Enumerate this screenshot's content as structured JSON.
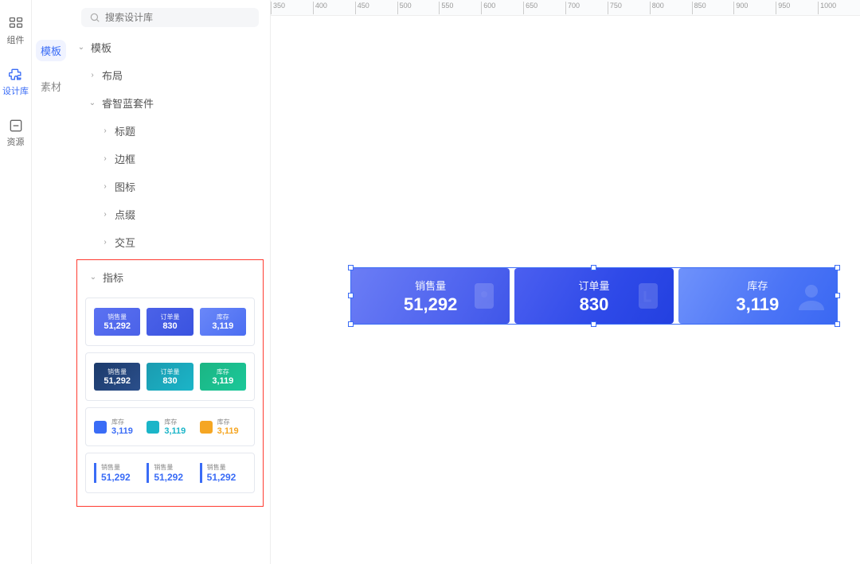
{
  "search": {
    "placeholder": "搜索设计库"
  },
  "rail": [
    {
      "id": "components",
      "label": "组件"
    },
    {
      "id": "design-lib",
      "label": "设计库"
    },
    {
      "id": "resources",
      "label": "资源"
    }
  ],
  "tabs": {
    "templates": "模板",
    "materials": "素材"
  },
  "tree": {
    "root": "模板",
    "layout": "布局",
    "kit": "睿智蓝套件",
    "kit_children": {
      "title": "标题",
      "border": "边框",
      "icon": "图标",
      "decor": "点缀",
      "interact": "交互",
      "metric": "指标"
    }
  },
  "thumbs": {
    "set_a": [
      {
        "label": "销售量",
        "value": "51,292"
      },
      {
        "label": "订单量",
        "value": "830"
      },
      {
        "label": "库存",
        "value": "3,119"
      }
    ],
    "set_b": [
      {
        "label": "销售量",
        "value": "51,292"
      },
      {
        "label": "订单量",
        "value": "830"
      },
      {
        "label": "库存",
        "value": "3,119"
      }
    ],
    "set_c": [
      {
        "label": "库存",
        "value": "3,119"
      },
      {
        "label": "库存",
        "value": "3,119"
      },
      {
        "label": "库存",
        "value": "3,119"
      }
    ],
    "set_d": [
      {
        "label": "销售量",
        "value": "51,292"
      },
      {
        "label": "销售量",
        "value": "51,292"
      },
      {
        "label": "销售量",
        "value": "51,292"
      }
    ]
  },
  "canvas": {
    "kpis": [
      {
        "label": "销售量",
        "value": "51,292"
      },
      {
        "label": "订单量",
        "value": "830"
      },
      {
        "label": "库存",
        "value": "3,119"
      }
    ]
  },
  "ruler": {
    "start": 350,
    "end": 1050,
    "step": 50
  }
}
